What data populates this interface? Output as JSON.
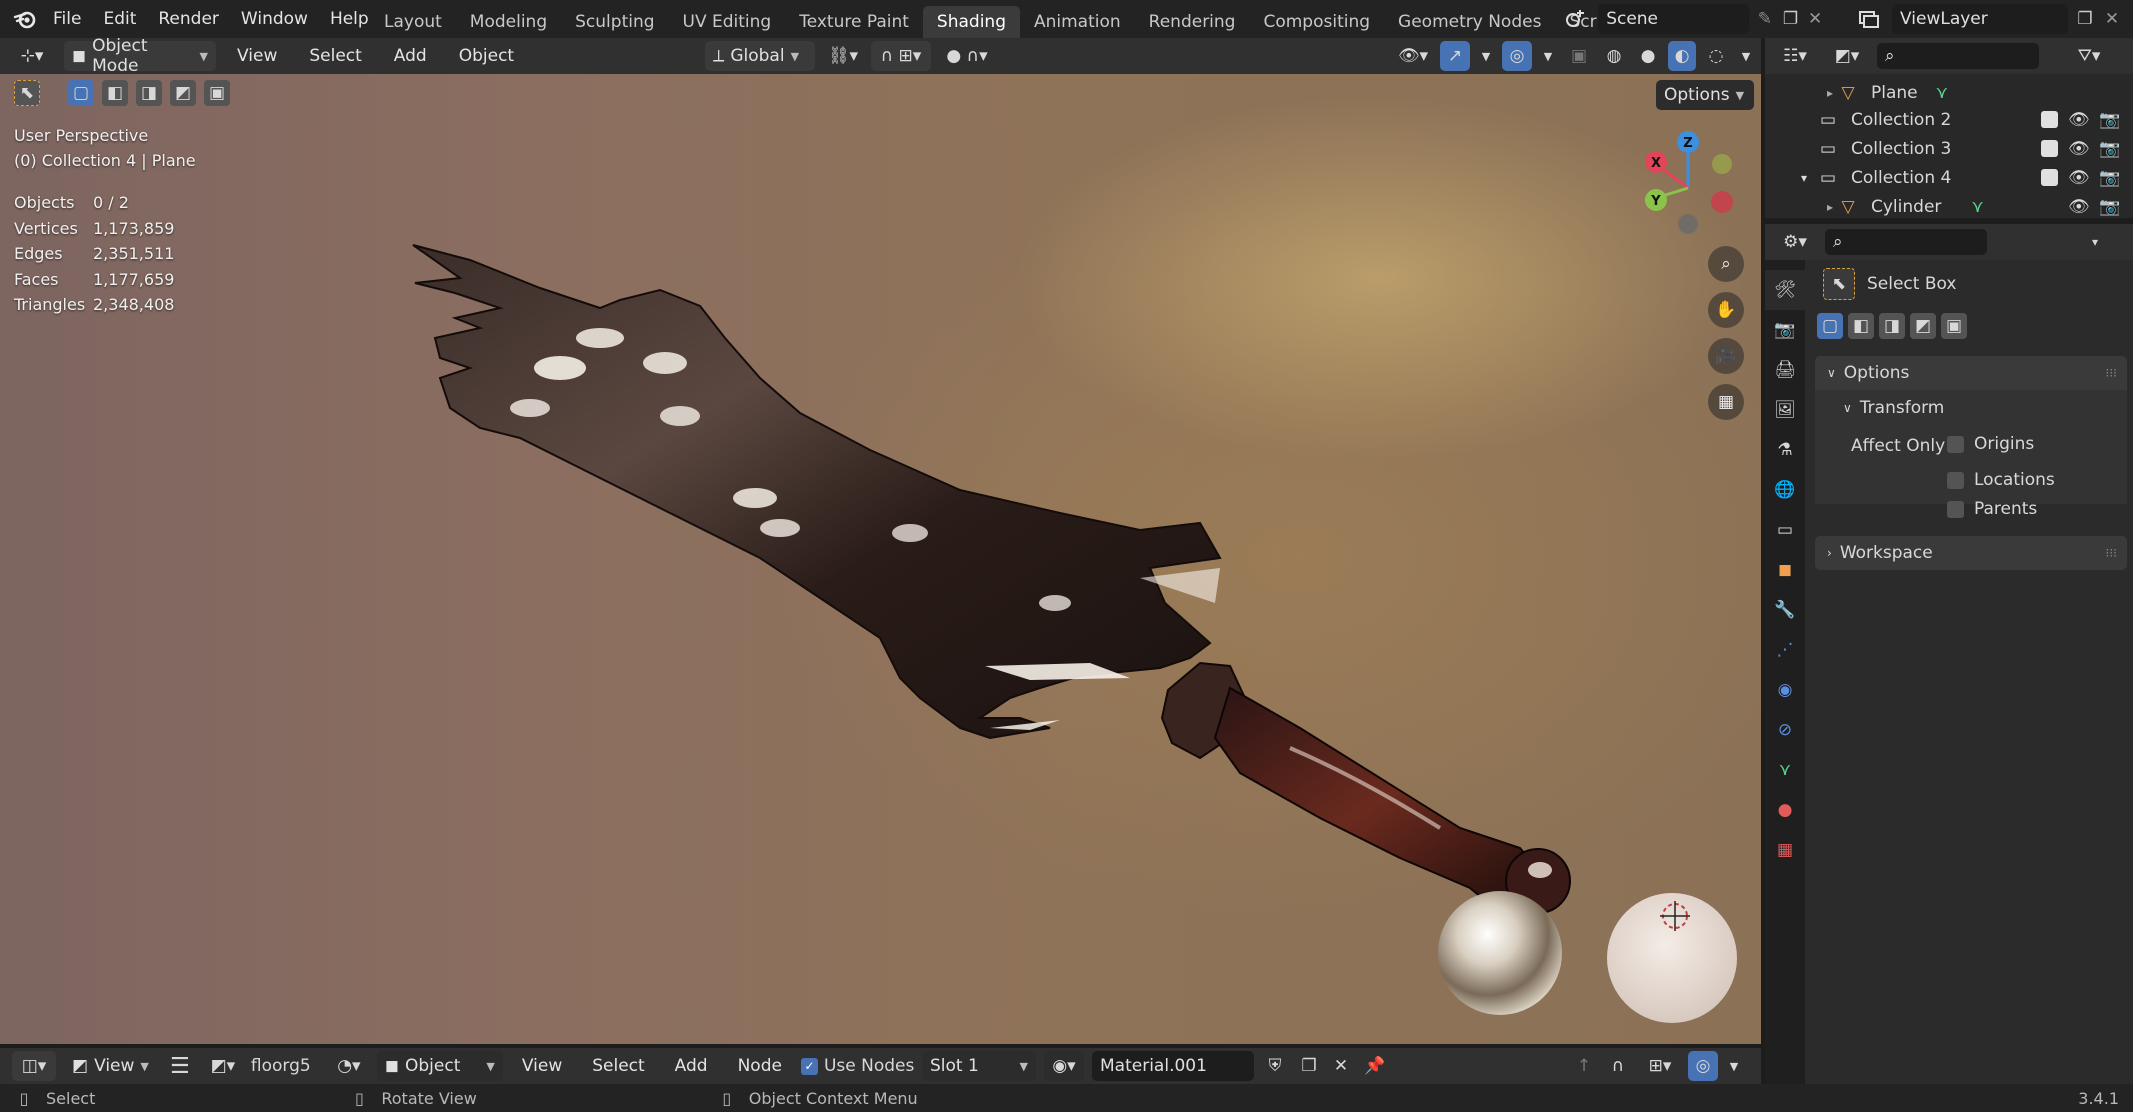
{
  "topbar": {
    "menus": [
      "File",
      "Edit",
      "Render",
      "Window",
      "Help"
    ],
    "workspaces": [
      "Layout",
      "Modeling",
      "Sculpting",
      "UV Editing",
      "Texture Paint",
      "Shading",
      "Animation",
      "Rendering",
      "Compositing",
      "Geometry Nodes",
      "Scripting"
    ],
    "active_workspace": "Shading",
    "scene": "Scene",
    "view_layer": "ViewLayer"
  },
  "viewport_header": {
    "mode": "Object Mode",
    "menus": [
      "View",
      "Select",
      "Add",
      "Object"
    ],
    "orientation": "Global",
    "options_label": "Options"
  },
  "viewport": {
    "perspective": "User Perspective",
    "context": "(0) Collection 4 | Plane",
    "stats": [
      {
        "label": "Objects",
        "value": "0 / 2"
      },
      {
        "label": "Vertices",
        "value": "1,173,859"
      },
      {
        "label": "Edges",
        "value": "2,351,511"
      },
      {
        "label": "Faces",
        "value": "1,177,659"
      },
      {
        "label": "Triangles",
        "value": "2,348,408"
      }
    ],
    "gizmo": {
      "x": "X",
      "y": "Y",
      "z": "Z",
      "x_color": "#e2445a",
      "y_color": "#8bc34a",
      "z_color": "#3d8fe0"
    }
  },
  "node_header": {
    "view": "View",
    "texture": "floorg5",
    "object_mode": "Object",
    "menus": [
      "View",
      "Select",
      "Add",
      "Node"
    ],
    "use_nodes_label": "Use Nodes",
    "use_nodes_checked": true,
    "slot": "Slot 1",
    "material": "Material.001"
  },
  "statusbar": {
    "select": "Select",
    "rotate": "Rotate View",
    "context_menu": "Object Context Menu",
    "version": "3.4.1"
  },
  "outliner": {
    "rows": [
      {
        "label": "Plane",
        "type": "mesh",
        "indent": 2,
        "expand": "▸"
      },
      {
        "label": "Collection 2",
        "type": "collection",
        "indent": 1,
        "expand": ""
      },
      {
        "label": "Collection 3",
        "type": "collection",
        "indent": 1,
        "expand": ""
      },
      {
        "label": "Collection 4",
        "type": "collection",
        "indent": 1,
        "expand": "▾"
      },
      {
        "label": "Cylinder",
        "type": "mesh",
        "indent": 2,
        "expand": "▸"
      }
    ]
  },
  "properties": {
    "tool_name": "Select Box",
    "options_label": "Options",
    "transform_label": "Transform",
    "affect_only_label": "Affect Only",
    "affect_items": [
      "Origins",
      "Locations",
      "Parents"
    ],
    "workspace_label": "Workspace",
    "tabs": [
      "tool",
      "render",
      "output",
      "view-layer",
      "scene",
      "world",
      "collection",
      "object",
      "modifiers",
      "particles",
      "physics",
      "constraints",
      "data",
      "material",
      "texture"
    ]
  },
  "colors": {
    "accent": "#4772b3",
    "active_tab": "#3b3b3b",
    "mesh_icon": "#f0a050",
    "data_icon": "#5fd38d"
  }
}
